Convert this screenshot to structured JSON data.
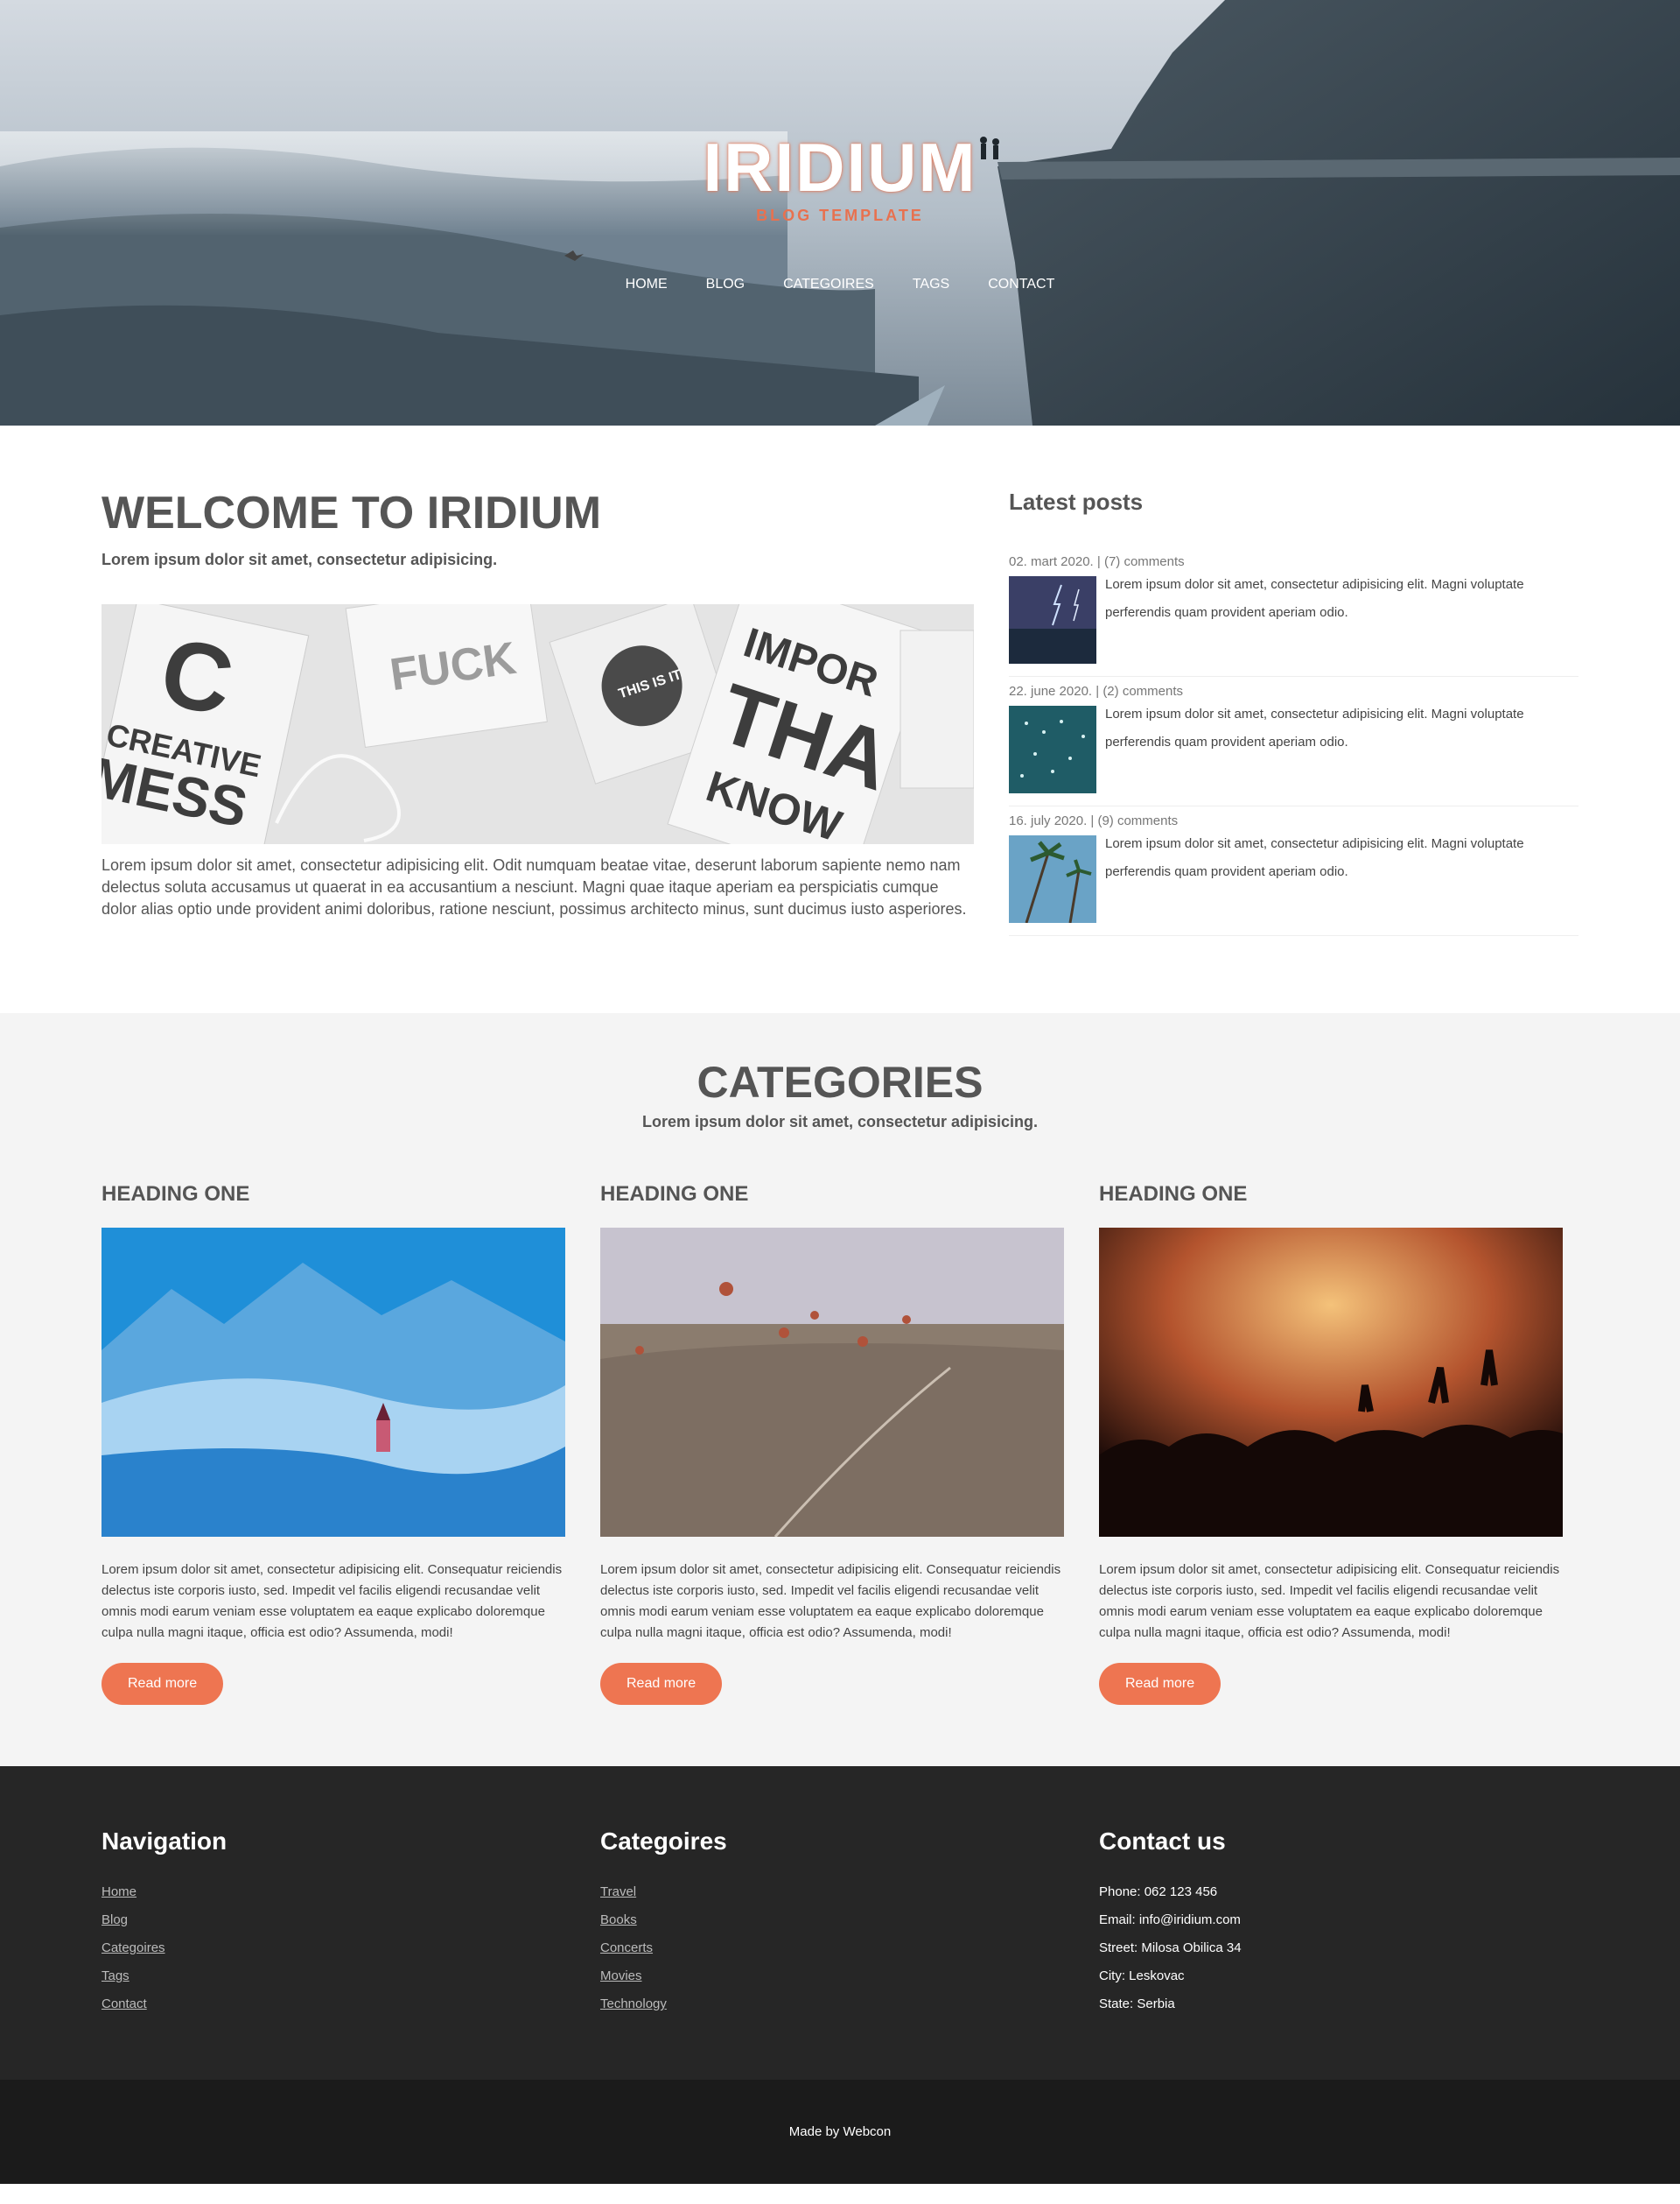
{
  "hero": {
    "title": "IRIDIUM",
    "subtitle": "BLOG TEMPLATE",
    "accent": "#e8714f"
  },
  "nav": {
    "items": [
      {
        "label": "HOME"
      },
      {
        "label": "BLOG"
      },
      {
        "label": "CATEGOIRES"
      },
      {
        "label": "TAGS"
      },
      {
        "label": "CONTACT"
      }
    ]
  },
  "welcome": {
    "title": "WELCOME TO IRIDIUM",
    "lead": "Lorem ipsum dolor sit amet, consectetur adipisicing.",
    "body": "Lorem ipsum dolor sit amet, consectetur adipisicing elit. Odit numquam beatae vitae, deserunt laborum sapiente nemo nam delectus soluta accusamus ut quaerat in ea accusantium a nesciunt. Magni quae itaque aperiam ea perspiciatis cumque dolor alias optio unde provident animi doloribus, ratione nesciunt, possimus architecto minus, sunt ducimus iusto asperiores.",
    "banner_words": [
      "C",
      "CREATIVE",
      "MESS",
      "FUCK",
      "THIS IS IT",
      "IMPOR",
      "THA",
      "KNOW"
    ]
  },
  "latest": {
    "title": "Latest posts",
    "posts": [
      {
        "meta": "02. mart 2020. | (7) comments",
        "text": "Lorem ipsum dolor sit amet, consectetur adipisicing elit. Magni voluptate perferendis quam provident aperiam odio."
      },
      {
        "meta": "22. june 2020. | (2) comments",
        "text": "Lorem ipsum dolor sit amet, consectetur adipisicing elit. Magni voluptate perferendis quam provident aperiam odio."
      },
      {
        "meta": "16. july 2020. | (9) comments",
        "text": "Lorem ipsum dolor sit amet, consectetur adipisicing elit. Magni voluptate perferendis quam provident aperiam odio."
      }
    ]
  },
  "categories": {
    "title": "CATEGORIES",
    "sub": "Lorem ipsum dolor sit amet, consectetur adipisicing.",
    "cards": [
      {
        "heading": "HEADING ONE",
        "text": "Lorem ipsum dolor sit amet, consectetur adipisicing elit. Consequatur reiciendis delectus iste corporis iusto, sed. Impedit vel facilis eligendi recusandae velit omnis modi earum veniam esse voluptatem ea eaque explicabo doloremque culpa nulla magni itaque, officia est odio? Assumenda, modi!",
        "button": "Read more"
      },
      {
        "heading": "HEADING ONE",
        "text": "Lorem ipsum dolor sit amet, consectetur adipisicing elit. Consequatur reiciendis delectus iste corporis iusto, sed. Impedit vel facilis eligendi recusandae velit omnis modi earum veniam esse voluptatem ea eaque explicabo doloremque culpa nulla magni itaque, officia est odio? Assumenda, modi!",
        "button": "Read more"
      },
      {
        "heading": "HEADING ONE",
        "text": "Lorem ipsum dolor sit amet, consectetur adipisicing elit. Consequatur reiciendis delectus iste corporis iusto, sed. Impedit vel facilis eligendi recusandae velit omnis modi earum veniam esse voluptatem ea eaque explicabo doloremque culpa nulla magni itaque, officia est odio? Assumenda, modi!",
        "button": "Read more"
      }
    ]
  },
  "footer": {
    "navigation": {
      "title": "Navigation",
      "links": [
        "Home",
        "Blog",
        "Categoires",
        "Tags",
        "Contact"
      ]
    },
    "categories": {
      "title": "Categoires",
      "links": [
        "Travel",
        "Books",
        "Concerts",
        "Movies",
        "Technology"
      ]
    },
    "contact": {
      "title": "Contact us",
      "lines": [
        "Phone: 062 123 456",
        "Email: info@iridium.com",
        "Street: Milosa Obilica 34",
        "City: Leskovac",
        "State: Serbia"
      ]
    },
    "credit": "Made by Webcon"
  },
  "colors": {
    "button": "#ee7551",
    "footer_bg": "#262626",
    "bottom_bg": "#1b1b1b",
    "section_bg": "#f4f4f4"
  }
}
